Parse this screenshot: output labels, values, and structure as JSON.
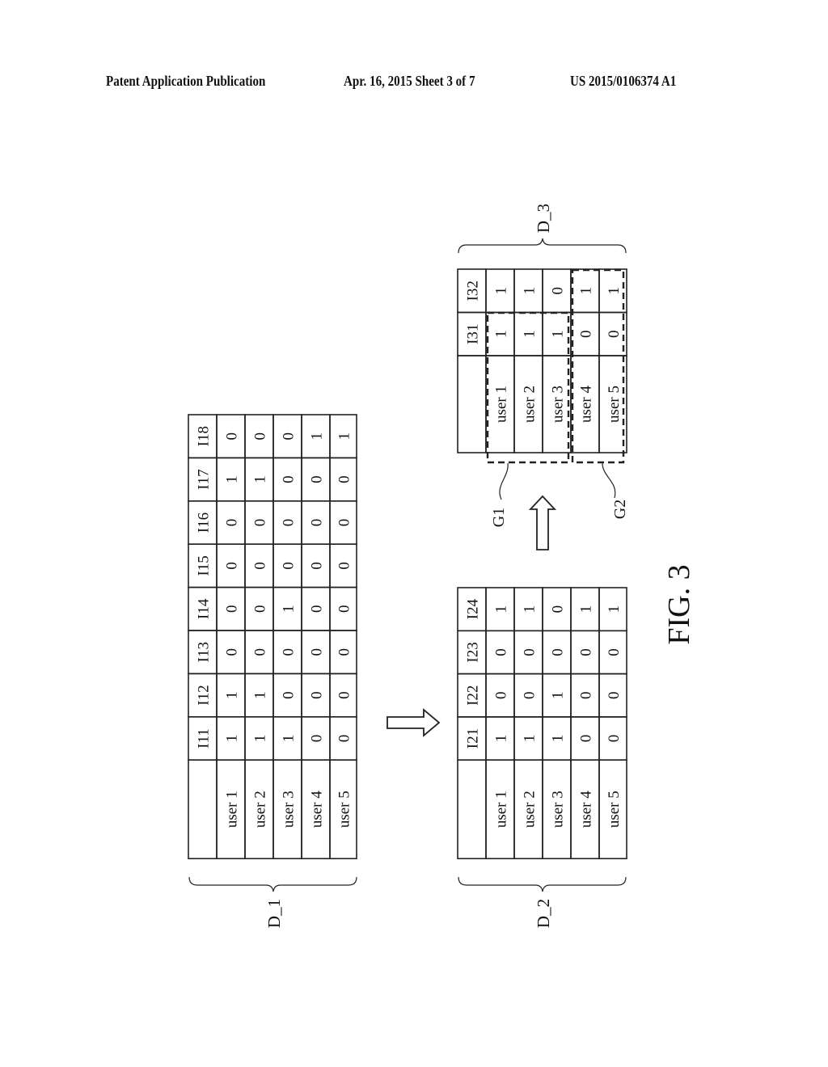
{
  "header": {
    "publication": "Patent Application Publication",
    "date_sheet": "Apr. 16, 2015  Sheet 3 of 7",
    "patent_number": "US 2015/0106374 A1"
  },
  "figure": {
    "label": "FIG. 3",
    "orientation": "rotated 90 degrees counter-clockwise",
    "tables": {
      "D_1": {
        "label": "D_1",
        "columns": [
          "I11",
          "I12",
          "I13",
          "I14",
          "I15",
          "I16",
          "I17",
          "I18"
        ],
        "rows": [
          {
            "user": "user 1",
            "values": [
              "1",
              "1",
              "0",
              "0",
              "0",
              "0",
              "1",
              "0"
            ]
          },
          {
            "user": "user 2",
            "values": [
              "1",
              "1",
              "0",
              "0",
              "0",
              "0",
              "1",
              "0"
            ]
          },
          {
            "user": "user 3",
            "values": [
              "1",
              "0",
              "0",
              "1",
              "0",
              "0",
              "0",
              "0"
            ]
          },
          {
            "user": "user 4",
            "values": [
              "0",
              "0",
              "0",
              "0",
              "0",
              "0",
              "0",
              "1"
            ]
          },
          {
            "user": "user 5",
            "values": [
              "0",
              "0",
              "0",
              "0",
              "0",
              "0",
              "0",
              "1"
            ]
          }
        ]
      },
      "D_2": {
        "label": "D_2",
        "columns": [
          "I21",
          "I22",
          "I23",
          "I24"
        ],
        "rows": [
          {
            "user": "user 1",
            "values": [
              "1",
              "0",
              "0",
              "1"
            ]
          },
          {
            "user": "user 2",
            "values": [
              "1",
              "0",
              "0",
              "1"
            ]
          },
          {
            "user": "user 3",
            "values": [
              "1",
              "1",
              "0",
              "0"
            ]
          },
          {
            "user": "user 4",
            "values": [
              "0",
              "0",
              "0",
              "1"
            ]
          },
          {
            "user": "user 5",
            "values": [
              "0",
              "0",
              "0",
              "1"
            ]
          }
        ]
      },
      "D_3": {
        "label": "D_3",
        "columns": [
          "I31",
          "I32"
        ],
        "rows": [
          {
            "user": "user 1",
            "values": [
              "1",
              "1"
            ]
          },
          {
            "user": "user 2",
            "values": [
              "1",
              "1"
            ]
          },
          {
            "user": "user 3",
            "values": [
              "1",
              "0"
            ]
          },
          {
            "user": "user 4",
            "values": [
              "0",
              "1"
            ]
          },
          {
            "user": "user 5",
            "values": [
              "0",
              "1"
            ]
          }
        ]
      }
    },
    "groups": [
      {
        "label": "G1",
        "members": [
          "user 1",
          "user 2",
          "user 3"
        ]
      },
      {
        "label": "G2",
        "members": [
          "user 4",
          "user 5"
        ]
      }
    ],
    "arrows": [
      {
        "from": "D_1",
        "to": "D_2"
      },
      {
        "from": "D_2",
        "to": "D_3"
      }
    ]
  }
}
